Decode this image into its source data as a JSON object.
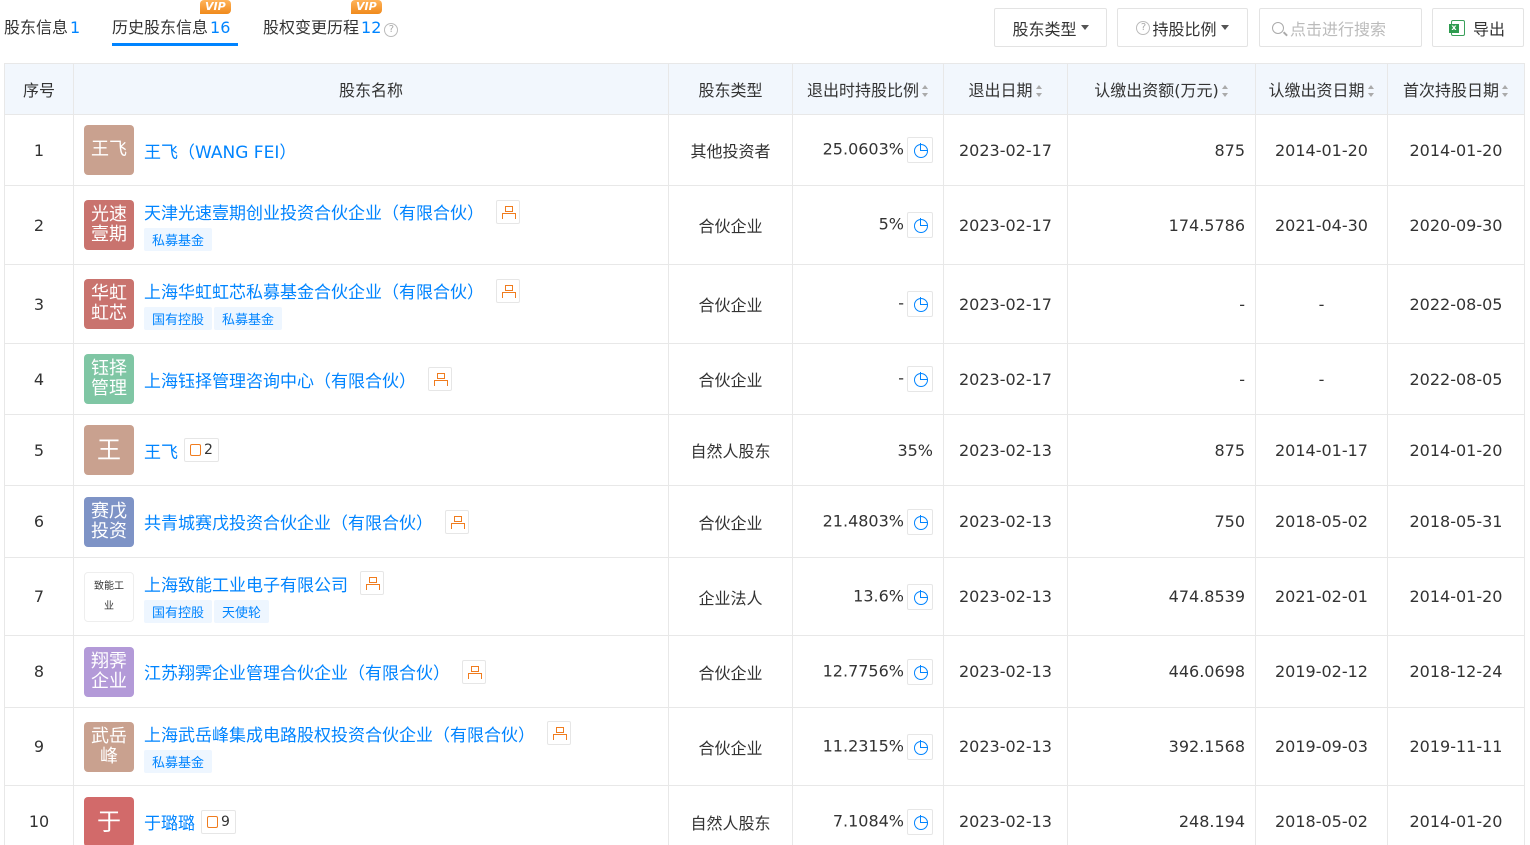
{
  "tabs": [
    {
      "label": "股东信息",
      "count": "1",
      "vip": ""
    },
    {
      "label": "历史股东信息",
      "count": "16",
      "vip": "VIP"
    },
    {
      "label": "股权变更历程",
      "count": "12",
      "vip": "VIP"
    }
  ],
  "toolbar": {
    "holder_type_label": "股东类型",
    "ratio_label": "持股比例",
    "search_placeholder": "点击进行搜索",
    "export_label": "导出"
  },
  "columns": [
    "序号",
    "股东名称",
    "股东类型",
    "退出时持股比例",
    "退出日期",
    "认缴出资额(万元)",
    "认缴出资日期",
    "首次持股日期"
  ],
  "colors": {
    "accent": "#0084ff",
    "header_bg": "#f2f7fd",
    "vip": "#f08a1c"
  },
  "rows": [
    {
      "idx": "1",
      "logo": "王飞",
      "logo_color": "#c9a18f",
      "name": "王飞（WANG FEI）",
      "struct": false,
      "rel": "",
      "tags": [],
      "type": "其他投资者",
      "ratio": "25.0603%",
      "pie": true,
      "exit_date": "2023-02-17",
      "amount": "875",
      "sub_date": "2014-01-20",
      "first_date": "2014-01-20"
    },
    {
      "idx": "2",
      "logo": "光速壹期",
      "logo_color": "#c9736e",
      "name": "天津光速壹期创业投资合伙企业（有限合伙）",
      "struct": true,
      "rel": "",
      "tags": [
        "私募基金"
      ],
      "type": "合伙企业",
      "ratio": "5%",
      "pie": true,
      "exit_date": "2023-02-17",
      "amount": "174.5786",
      "sub_date": "2021-04-30",
      "first_date": "2020-09-30"
    },
    {
      "idx": "3",
      "logo": "华虹虹芯",
      "logo_color": "#c9736e",
      "name": "上海华虹虹芯私募基金合伙企业（有限合伙）",
      "struct": true,
      "rel": "",
      "tags": [
        "国有控股",
        "私募基金"
      ],
      "type": "合伙企业",
      "ratio": "-",
      "pie": true,
      "exit_date": "2023-02-17",
      "amount": "-",
      "sub_date": "-",
      "first_date": "2022-08-05"
    },
    {
      "idx": "4",
      "logo": "钰择管理",
      "logo_color": "#7fc6a4",
      "name": "上海钰择管理咨询中心（有限合伙）",
      "struct": true,
      "rel": "",
      "tags": [],
      "type": "合伙企业",
      "ratio": "-",
      "pie": true,
      "exit_date": "2023-02-17",
      "amount": "-",
      "sub_date": "-",
      "first_date": "2022-08-05"
    },
    {
      "idx": "5",
      "logo": "王",
      "logo_color": "#c9a18f",
      "name": "王飞",
      "struct": false,
      "rel": "2",
      "tags": [],
      "type": "自然人股东",
      "ratio": "35%",
      "pie": false,
      "exit_date": "2023-02-13",
      "amount": "875",
      "sub_date": "2014-01-17",
      "first_date": "2014-01-20"
    },
    {
      "idx": "6",
      "logo": "赛戊投资",
      "logo_color": "#7e93c6",
      "name": "共青城赛戊投资合伙企业（有限合伙）",
      "struct": true,
      "rel": "",
      "tags": [],
      "type": "合伙企业",
      "ratio": "21.4803%",
      "pie": true,
      "exit_date": "2023-02-13",
      "amount": "750",
      "sub_date": "2018-05-02",
      "first_date": "2018-05-31"
    },
    {
      "idx": "7",
      "logo": "致能工业",
      "logo_color": "#ffffff",
      "name": "上海致能工业电子有限公司",
      "struct": true,
      "rel": "",
      "tags": [
        "国有控股",
        "天使轮"
      ],
      "type": "企业法人",
      "ratio": "13.6%",
      "pie": true,
      "exit_date": "2023-02-13",
      "amount": "474.8539",
      "sub_date": "2021-02-01",
      "first_date": "2014-01-20"
    },
    {
      "idx": "8",
      "logo": "翔霁企业",
      "logo_color": "#b39ad8",
      "name": "江苏翔霁企业管理合伙企业（有限合伙）",
      "struct": true,
      "rel": "",
      "tags": [],
      "type": "合伙企业",
      "ratio": "12.7756%",
      "pie": true,
      "exit_date": "2023-02-13",
      "amount": "446.0698",
      "sub_date": "2019-02-12",
      "first_date": "2018-12-24"
    },
    {
      "idx": "9",
      "logo": "武岳峰",
      "logo_color": "#c9a18f",
      "name": "上海武岳峰集成电路股权投资合伙企业（有限合伙）",
      "struct": true,
      "rel": "",
      "tags": [
        "私募基金"
      ],
      "type": "合伙企业",
      "ratio": "11.2315%",
      "pie": true,
      "exit_date": "2023-02-13",
      "amount": "392.1568",
      "sub_date": "2019-09-03",
      "first_date": "2019-11-11"
    },
    {
      "idx": "10",
      "logo": "于",
      "logo_color": "#d26a6a",
      "name": "于璐璐",
      "struct": false,
      "rel": "9",
      "tags": [],
      "type": "自然人股东",
      "ratio": "7.1084%",
      "pie": true,
      "exit_date": "2023-02-13",
      "amount": "248.194",
      "sub_date": "2018-05-02",
      "first_date": "2014-01-20"
    }
  ]
}
